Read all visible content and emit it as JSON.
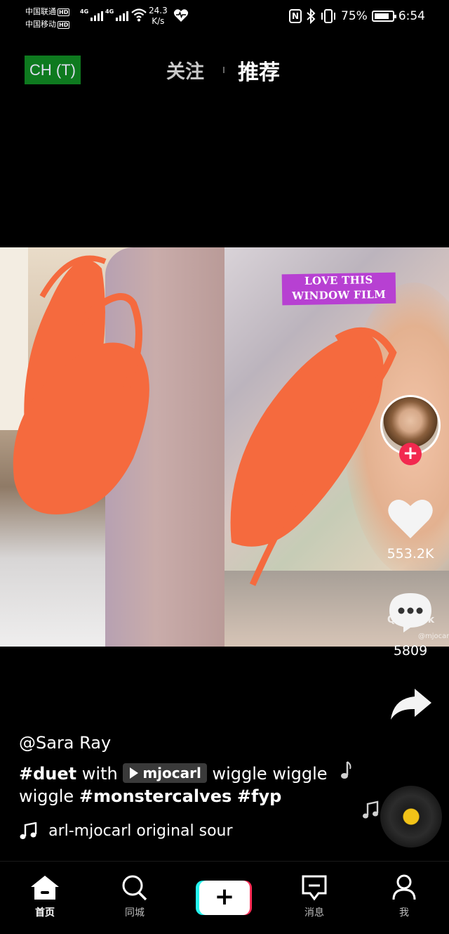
{
  "status_bar": {
    "carrier1": "中国联通",
    "carrier2": "中国移动",
    "hd": "HD",
    "net1": "4G",
    "net2": "4G",
    "speed_value": "24.3",
    "speed_unit": "K/s",
    "nfc": "N",
    "battery": "75%",
    "time": "6:54"
  },
  "top_bar": {
    "language_button": "CH (T)",
    "tab_following": "关注",
    "tab_recommended": "推荐"
  },
  "video": {
    "sticker_line1": "LOVE THIS",
    "sticker_line2": "WINDOW FILM",
    "watermark": "Q TikTok",
    "watermark_user": "@mjocarl"
  },
  "actions": {
    "like_count": "553.2K",
    "comment_count": "5809",
    "follow_plus": "+"
  },
  "caption": {
    "author": "@Sara Ray",
    "hashtag_duet": "#duet",
    "with": "with",
    "mention": "mjocarl",
    "text_after_mention": "wiggle wiggle",
    "text_line2": "wiggle",
    "hashtag_monster": "#monstercalves",
    "hashtag_fyp": "#fyp",
    "music": "carl-mjocarl    original sour"
  },
  "bottom_nav": {
    "home": "首页",
    "nearby": "同城",
    "create": "+",
    "messages": "消息",
    "me": "我"
  },
  "colors": {
    "language_button_bg": "#0e7a1f",
    "sticker_bg": "#b740d2",
    "scribble": "#f56a3e",
    "plus_red": "#fe2c55",
    "plus_cyan": "#25f4ee",
    "disc_center": "#f2c318"
  }
}
